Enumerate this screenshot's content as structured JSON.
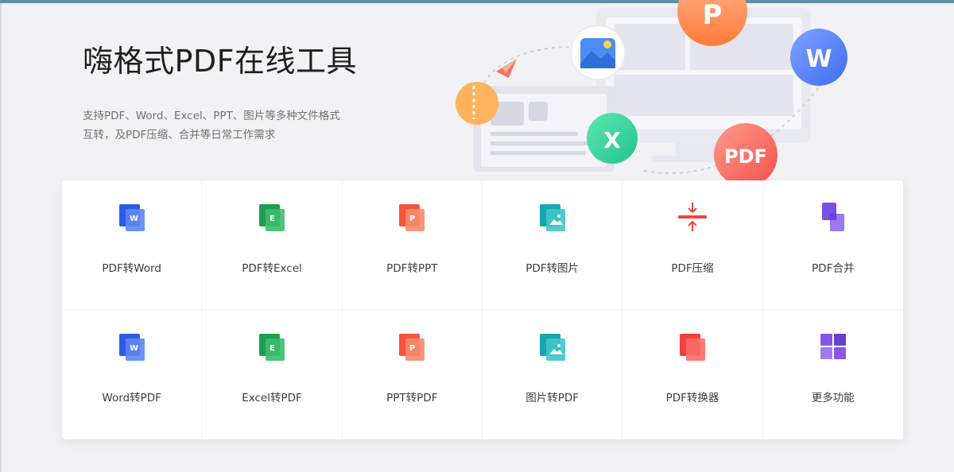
{
  "hero": {
    "title": "嗨格式PDF在线工具",
    "desc_line1": "支持PDF、Word、Excel、PPT、图片等多种文件格式",
    "desc_line2": "互转，及PDF压缩、合并等日常工作需求"
  },
  "illustration": {
    "p_badge": "P",
    "w_badge": "W",
    "x_badge": "X",
    "pdf_badge": "PDF",
    "colors": {
      "orange": "#ff8a3d",
      "blue": "#4d7cff",
      "green": "#2fd59a",
      "red": "#fe5f5f"
    }
  },
  "tools": [
    {
      "label": "PDF转Word",
      "icon": "word-doc-icon"
    },
    {
      "label": "PDF转Excel",
      "icon": "excel-doc-icon"
    },
    {
      "label": "PDF转PPT",
      "icon": "ppt-doc-icon"
    },
    {
      "label": "PDF转图片",
      "icon": "image-doc-icon"
    },
    {
      "label": "PDF压缩",
      "icon": "compress-icon"
    },
    {
      "label": "PDF合并",
      "icon": "merge-icon"
    },
    {
      "label": "Word转PDF",
      "icon": "word-doc-icon"
    },
    {
      "label": "Excel转PDF",
      "icon": "excel-doc-icon"
    },
    {
      "label": "PPT转PDF",
      "icon": "ppt-doc-icon"
    },
    {
      "label": "图片转PDF",
      "icon": "image-doc-icon"
    },
    {
      "label": "PDF转换器",
      "icon": "converter-icon"
    },
    {
      "label": "更多功能",
      "icon": "grid-more-icon"
    }
  ],
  "icon_colors": {
    "word": "#2b5ce6",
    "excel": "#1e9e52",
    "ppt": "#f4553c",
    "image": "#16a6ad",
    "compress": "#f0443b",
    "merge": "#7b4fe3",
    "converter": "#f2403e",
    "more": "#8a55e6"
  }
}
